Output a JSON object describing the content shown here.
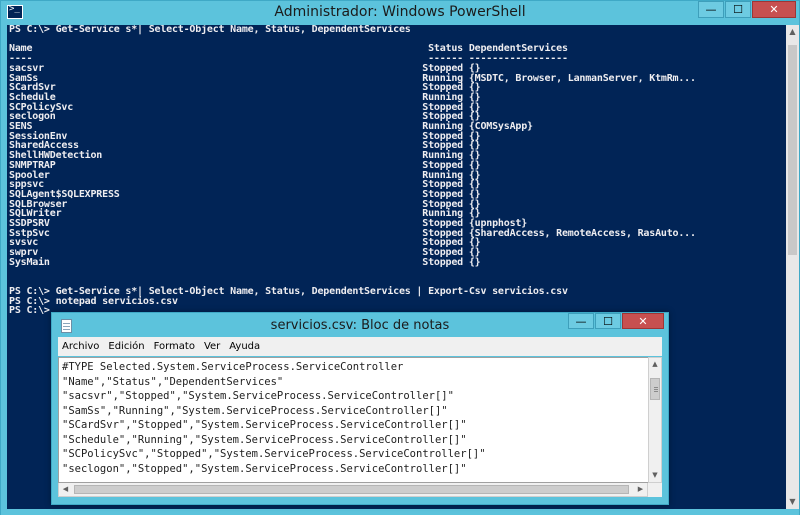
{
  "powershell": {
    "title": "Administrador: Windows PowerShell",
    "console_lines": [
      "PS C:\\> Get-Service s*| Select-Object Name, Status, DependentServices",
      "",
      "Name                                                                    Status DependentServices",
      "----                                                                    ------ -----------------",
      "sacsvr                                                                 Stopped {}",
      "SamSs                                                                  Running {MSDTC, Browser, LanmanServer, KtmRm...",
      "SCardSvr                                                               Stopped {}",
      "Schedule                                                               Running {}",
      "SCPolicySvc                                                            Stopped {}",
      "seclogon                                                               Stopped {}",
      "SENS                                                                   Running {COMSysApp}",
      "SessionEnv                                                             Stopped {}",
      "SharedAccess                                                           Stopped {}",
      "ShellHWDetection                                                       Running {}",
      "SNMPTRAP                                                               Stopped {}",
      "Spooler                                                                Running {}",
      "sppsvc                                                                 Stopped {}",
      "SQLAgent$SQLEXPRESS                                                    Stopped {}",
      "SQLBrowser                                                             Stopped {}",
      "SQLWriter                                                              Running {}",
      "SSDPSRV                                                                Stopped {upnphost}",
      "SstpSvc                                                                Stopped {SharedAccess, RemoteAccess, RasAuto...",
      "svsvc                                                                  Stopped {}",
      "swprv                                                                  Stopped {}",
      "SysMain                                                                Stopped {}",
      "",
      "",
      "PS C:\\> Get-Service s*| Select-Object Name, Status, DependentServices | Export-Csv servicios.csv",
      "PS C:\\> notepad servicios.csv",
      "PS C:\\>"
    ]
  },
  "notepad": {
    "title": "servicios.csv: Bloc de notas",
    "menu": [
      "Archivo",
      "Edición",
      "Formato",
      "Ver",
      "Ayuda"
    ],
    "lines": [
      "#TYPE Selected.System.ServiceProcess.ServiceController",
      "\"Name\",\"Status\",\"DependentServices\"",
      "\"sacsvr\",\"Stopped\",\"System.ServiceProcess.ServiceController[]\"",
      "\"SamSs\",\"Running\",\"System.ServiceProcess.ServiceController[]\"",
      "\"SCardSvr\",\"Stopped\",\"System.ServiceProcess.ServiceController[]\"",
      "\"Schedule\",\"Running\",\"System.ServiceProcess.ServiceController[]\"",
      "\"SCPolicySvc\",\"Stopped\",\"System.ServiceProcess.ServiceController[]\"",
      "\"seclogon\",\"Stopped\",\"System.ServiceProcess.ServiceController[]\""
    ]
  },
  "window_controls": {
    "minimize": "—",
    "maximize": "☐",
    "close": "✕"
  },
  "colors": {
    "console_bg": "#012456",
    "console_fg": "#eeedf0",
    "title_bar": "#5cc3dc",
    "close_button": "#c75050"
  },
  "icons": [
    "powershell-icon",
    "notepad-icon",
    "minimize-icon",
    "maximize-icon",
    "close-icon",
    "scroll-up-icon",
    "scroll-down-icon",
    "scroll-left-icon",
    "scroll-right-icon"
  ]
}
